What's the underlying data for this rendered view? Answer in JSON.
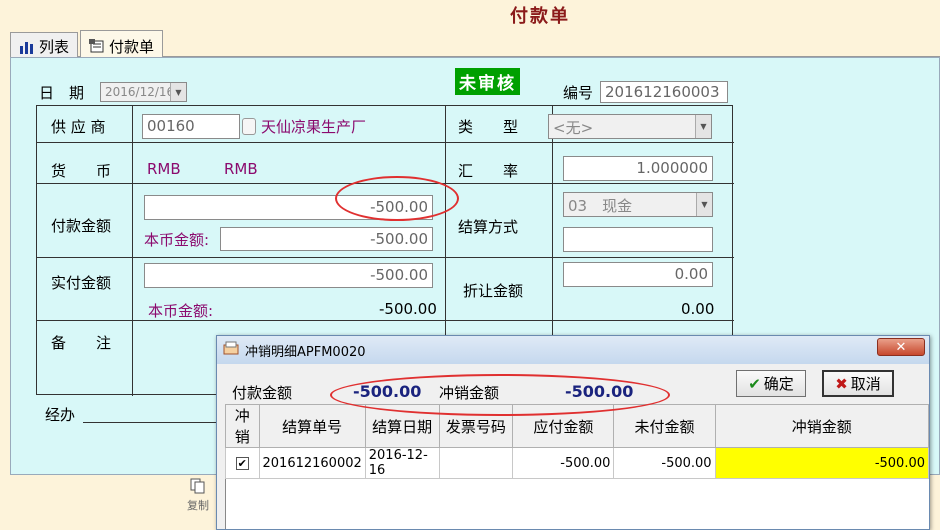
{
  "window": {
    "title": "付款单"
  },
  "tabs": [
    {
      "label": "列表",
      "icon": "bar-chart-icon"
    },
    {
      "label": "付款单",
      "icon": "form-icon"
    }
  ],
  "form": {
    "date_label": "日　期",
    "date_value": "2016/12/16",
    "status": "未审核",
    "number_label": "编号",
    "number_value": "201612160003",
    "supplier_label": "供 应 商",
    "supplier_code": "00160",
    "supplier_name": "天仙凉果生产厂",
    "type_label": "类　　型",
    "type_value": "<无>",
    "currency_label": "货　　币",
    "currency_code": "RMB",
    "currency_name": "RMB",
    "rate_label": "汇　　率",
    "rate_value": "1.000000",
    "pay_amount_label": "付款金额",
    "pay_amount_value": "-500.00",
    "local_amount_label": "本币金额:",
    "local_amount_value": "-500.00",
    "settle_label": "结算方式",
    "settle_value": "03　现金",
    "settle_extra": "",
    "actual_label": "实付金额",
    "actual_value": "-500.00",
    "actual_local_label": "本币金额:",
    "actual_local_value": "-500.00",
    "discount_label": "折让金额",
    "discount_value": "0.00",
    "discount_local_value": "0.00",
    "remark_label": "备　　注",
    "handler_label": "经办"
  },
  "toolbar": {
    "copy_label": "复制"
  },
  "dialog": {
    "title": "冲销明细APFM0020",
    "pay_amount_label": "付款金额",
    "pay_amount_value": "-500.00",
    "offset_amount_label": "冲销金额",
    "offset_amount_value": "-500.00",
    "ok_label": "确定",
    "cancel_label": "取消",
    "columns": [
      "冲销",
      "结算单号",
      "结算日期",
      "发票号码",
      "应付金额",
      "未付金额",
      "冲销金额"
    ],
    "rows": [
      {
        "checked": "✔",
        "settle_no": "201612160002",
        "settle_date": "2016-12-16",
        "invoice_no": "",
        "payable": "-500.00",
        "unpaid": "-500.00",
        "offset": "-500.00"
      }
    ]
  }
}
